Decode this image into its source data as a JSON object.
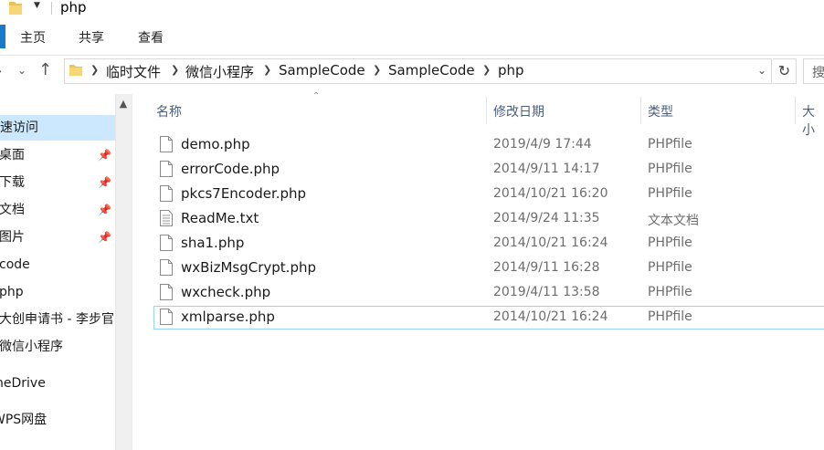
{
  "window": {
    "title": "php"
  },
  "ribbon": {
    "tabs": [
      "主页",
      "共享",
      "查看"
    ]
  },
  "address": {
    "crumbs": [
      "临时文件",
      "微信小程序",
      "SampleCode",
      "SampleCode",
      "php"
    ],
    "search_placeholder": "搜"
  },
  "nav": {
    "items": [
      {
        "label": "快速访问",
        "selected": true,
        "pinned": false
      },
      {
        "label": "桌面",
        "pinned": true
      },
      {
        "label": "下载",
        "pinned": true
      },
      {
        "label": "文档",
        "pinned": true
      },
      {
        "label": "图片",
        "pinned": true
      },
      {
        "label": "code",
        "pinned": false
      },
      {
        "label": "php",
        "pinned": false
      },
      {
        "label": "大创申请书 - 李步官",
        "pinned": false
      },
      {
        "label": "微信小程序",
        "pinned": false
      },
      {
        "label": "OneDrive",
        "pinned": false
      },
      {
        "label": "WPS网盘",
        "pinned": false
      }
    ]
  },
  "list": {
    "columns": {
      "name": "名称",
      "modified": "修改日期",
      "type": "类型",
      "size": "大小"
    },
    "files": [
      {
        "name": "demo.php",
        "modified": "2019/4/9 17:44",
        "type": "PHPfile",
        "icon": "blank-file-icon"
      },
      {
        "name": "errorCode.php",
        "modified": "2014/9/11 14:17",
        "type": "PHPfile",
        "icon": "blank-file-icon"
      },
      {
        "name": "pkcs7Encoder.php",
        "modified": "2014/10/21 16:20",
        "type": "PHPfile",
        "icon": "blank-file-icon"
      },
      {
        "name": "ReadMe.txt",
        "modified": "2014/9/24 11:35",
        "type": "文本文档",
        "icon": "text-file-icon"
      },
      {
        "name": "sha1.php",
        "modified": "2014/10/21 16:24",
        "type": "PHPfile",
        "icon": "blank-file-icon"
      },
      {
        "name": "wxBizMsgCrypt.php",
        "modified": "2014/9/11 16:28",
        "type": "PHPfile",
        "icon": "blank-file-icon"
      },
      {
        "name": "wxcheck.php",
        "modified": "2019/4/11 13:58",
        "type": "PHPfile",
        "icon": "blank-file-icon"
      },
      {
        "name": "xmlparse.php",
        "modified": "2014/10/21 16:24",
        "type": "PHPfile",
        "icon": "blank-file-icon",
        "focused": true
      }
    ]
  },
  "colors": {
    "accent": "#1979ca",
    "selection": "#cce8ff",
    "focus_border": "#99d1ff",
    "header_text": "#4c607a"
  }
}
